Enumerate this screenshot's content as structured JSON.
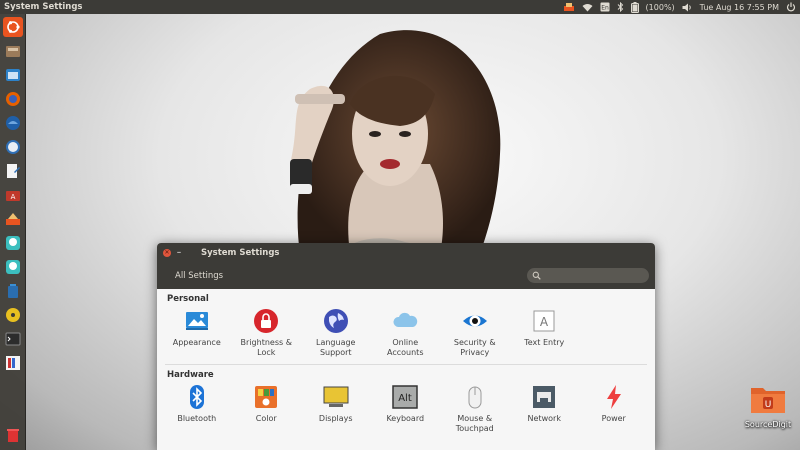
{
  "top_panel": {
    "app_title": "System Settings",
    "battery": "(100%)",
    "datetime": "Tue Aug 16  7:55 PM"
  },
  "desktop": {
    "icon_label": "SourceDigit"
  },
  "window": {
    "title": "System Settings",
    "toolbar_button": "All Settings",
    "search_placeholder": ""
  },
  "sections": {
    "personal": {
      "title": "Personal",
      "items": [
        {
          "label": "Appearance",
          "icon": "appearance-icon"
        },
        {
          "label": "Brightness &\nLock",
          "icon": "lock-icon"
        },
        {
          "label": "Language\nSupport",
          "icon": "globe-icon"
        },
        {
          "label": "Online\nAccounts",
          "icon": "cloud-icon"
        },
        {
          "label": "Security &\nPrivacy",
          "icon": "eye-icon"
        },
        {
          "label": "Text Entry",
          "icon": "text-entry-icon"
        }
      ]
    },
    "hardware": {
      "title": "Hardware",
      "items": [
        {
          "label": "Bluetooth",
          "icon": "bluetooth-icon"
        },
        {
          "label": "Color",
          "icon": "color-icon"
        },
        {
          "label": "Displays",
          "icon": "display-icon"
        },
        {
          "label": "Keyboard",
          "icon": "keyboard-icon"
        },
        {
          "label": "Mouse &\nTouchpad",
          "icon": "mouse-icon"
        },
        {
          "label": "Network",
          "icon": "network-icon"
        },
        {
          "label": "Power",
          "icon": "power-icon"
        }
      ]
    }
  },
  "keyboard_key_text": "Alt",
  "text_entry_key": "A",
  "colors": {
    "panel_bg": "#3c3b37",
    "close_button": "#e0553c",
    "accent_orange": "#e95420"
  }
}
